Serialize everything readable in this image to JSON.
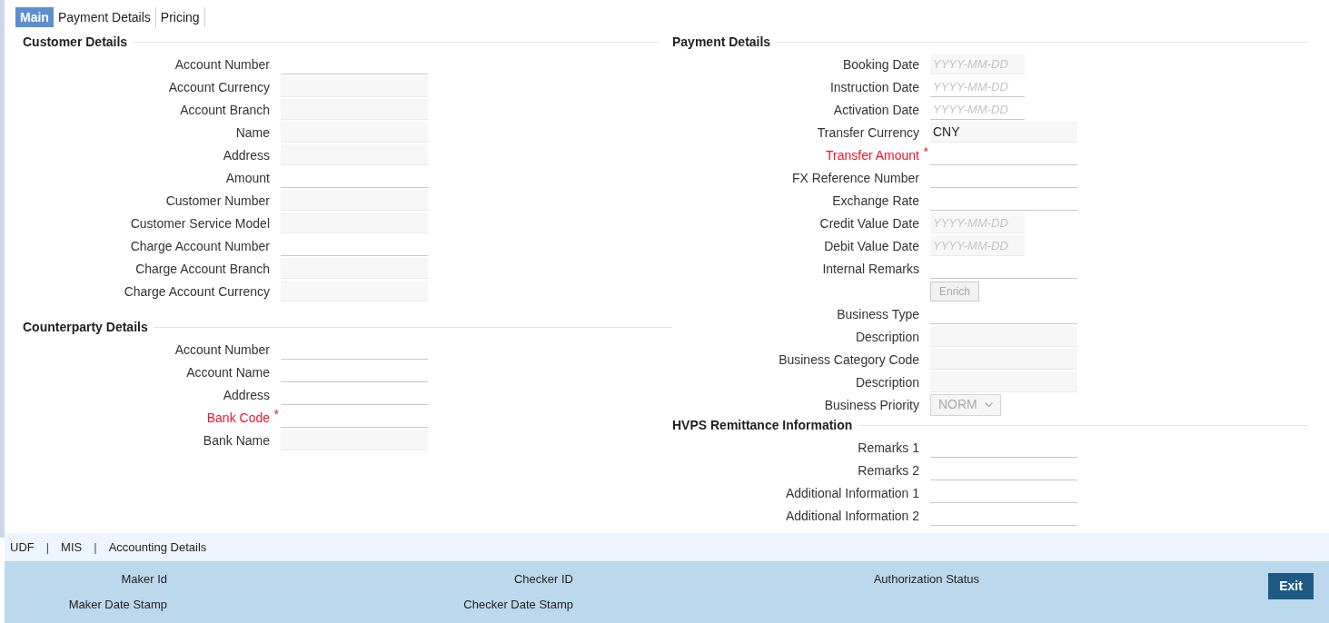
{
  "tabs": [
    {
      "label": "Main",
      "selected": true
    },
    {
      "label": "Payment Details",
      "selected": false
    },
    {
      "label": "Pricing",
      "selected": false
    }
  ],
  "left_sections": [
    {
      "title": "Customer Details",
      "fields": [
        {
          "label": "Account Number",
          "kind": "text",
          "editable": true
        },
        {
          "label": "Account Currency",
          "kind": "text",
          "editable": false
        },
        {
          "label": "Account Branch",
          "kind": "text",
          "editable": false
        },
        {
          "label": "Name",
          "kind": "text",
          "editable": false
        },
        {
          "label": "Address",
          "kind": "text",
          "editable": false
        },
        {
          "label": "Amount",
          "kind": "text",
          "editable": true
        },
        {
          "label": "Customer Number",
          "kind": "text",
          "editable": false
        },
        {
          "label": "Customer Service Model",
          "kind": "text",
          "editable": false
        },
        {
          "label": "Charge Account Number",
          "kind": "text",
          "editable": true
        },
        {
          "label": "Charge Account Branch",
          "kind": "text",
          "editable": false
        },
        {
          "label": "Charge Account Currency",
          "kind": "text",
          "editable": false
        }
      ]
    },
    {
      "title": "Counterparty Details",
      "fields": [
        {
          "label": "Account Number",
          "kind": "text",
          "editable": true
        },
        {
          "label": "Account Name",
          "kind": "text",
          "editable": true
        },
        {
          "label": "Address",
          "kind": "text",
          "editable": true
        },
        {
          "label": "Bank Code",
          "kind": "text",
          "editable": true,
          "required": true,
          "mark": "*"
        },
        {
          "label": "Bank Name",
          "kind": "text",
          "editable": false
        }
      ]
    }
  ],
  "right_sections": [
    {
      "title": "Payment Details",
      "fields": [
        {
          "label": "Booking Date",
          "kind": "date",
          "editable": false,
          "placeholder": "YYYY-MM-DD"
        },
        {
          "label": "Instruction Date",
          "kind": "date",
          "editable": true,
          "placeholder": "YYYY-MM-DD"
        },
        {
          "label": "Activation Date",
          "kind": "date",
          "editable": true,
          "placeholder": "YYYY-MM-DD"
        },
        {
          "label": "Transfer Currency",
          "kind": "text",
          "editable": false,
          "value": "CNY"
        },
        {
          "label": "Transfer Amount",
          "kind": "text",
          "editable": true,
          "required": true,
          "mark": "*"
        },
        {
          "label": "FX Reference Number",
          "kind": "text",
          "editable": true
        },
        {
          "label": "Exchange Rate",
          "kind": "text",
          "editable": true
        },
        {
          "label": "Credit Value Date",
          "kind": "date",
          "editable": false,
          "placeholder": "YYYY-MM-DD"
        },
        {
          "label": "Debit Value Date",
          "kind": "date",
          "editable": false,
          "placeholder": "YYYY-MM-DD"
        },
        {
          "label": "Internal Remarks",
          "kind": "text",
          "editable": true
        },
        {
          "kind": "button",
          "value": "Enrich",
          "disabled": true
        },
        {
          "label": "Business Type",
          "kind": "text",
          "editable": true
        },
        {
          "label": "Description",
          "kind": "text",
          "editable": false
        },
        {
          "label": "Business Category Code",
          "kind": "text",
          "editable": false
        },
        {
          "label": "Description",
          "kind": "text",
          "editable": false
        },
        {
          "label": "Business Priority",
          "kind": "select",
          "value": "NORM",
          "disabled": true
        }
      ]
    },
    {
      "title": "HVPS Remittance Information",
      "fields": [
        {
          "label": "Remarks 1",
          "kind": "text",
          "editable": true
        },
        {
          "label": "Remarks 2",
          "kind": "text",
          "editable": true
        },
        {
          "label": "Additional Information 1",
          "kind": "text",
          "editable": true
        },
        {
          "label": "Additional Information 2",
          "kind": "text",
          "editable": true
        }
      ]
    }
  ],
  "footer_links": [
    {
      "label": "UDF",
      "separator": "|"
    },
    {
      "label": "MIS",
      "separator": "|"
    },
    {
      "label": "Accounting Details"
    }
  ],
  "audit": [
    [
      "Maker Id",
      "Maker Date Stamp"
    ],
    [
      "Checker ID",
      "Checker Date Stamp"
    ],
    [
      "Authorization Status"
    ]
  ],
  "exit_button": "Exit"
}
